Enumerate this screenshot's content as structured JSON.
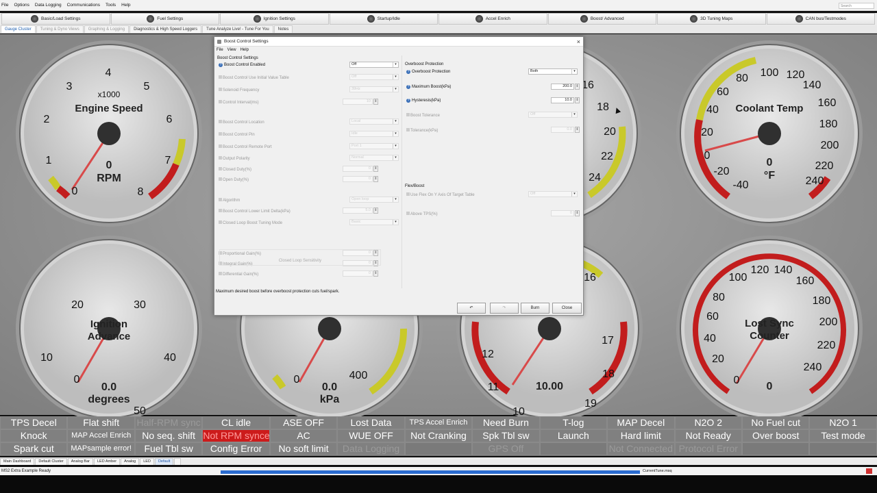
{
  "menu": [
    "File",
    "Options",
    "Data Logging",
    "Communications",
    "Tools",
    "Help"
  ],
  "search_placeholder": "Search",
  "toolbar": [
    "Basic/Load Settings",
    "Fuel Settings",
    "Ignition Settings",
    "Startup/Idle",
    "Accel Enrich",
    "Boost/ Advanced",
    "3D Tuning Maps",
    "CAN bus/Testmodes"
  ],
  "tabs": [
    "Gauge Cluster",
    "Tuning & Dyno Views",
    "Graphing & Logging",
    "Diagnostics & High Speed Loggers",
    "Tune Analyze Live! - Tune For You",
    "Notes"
  ],
  "gauges": {
    "rpm": {
      "title": "Engine Speed",
      "multiplier": "x1000",
      "value": "0",
      "unit": "RPM",
      "ticks": [
        "0",
        "1",
        "2",
        "3",
        "4",
        "5",
        "6",
        "7",
        "8"
      ]
    },
    "coolant": {
      "title": "Coolant Temp",
      "value": "0",
      "unit": "°F",
      "ticks": [
        "-40",
        "-20",
        "0",
        "20",
        "40",
        "60",
        "80",
        "100",
        "120",
        "140",
        "160",
        "180",
        "200",
        "220",
        "240"
      ]
    },
    "ignition": {
      "title_line1": "Ignition",
      "title_line2": "Advance",
      "value": "0.0",
      "unit": "degrees",
      "ticks": [
        "0",
        "10",
        "20",
        "30",
        "40",
        "50"
      ]
    },
    "map": {
      "value": "0.0",
      "unit": "kPa",
      "ticks": [
        "0",
        "400"
      ]
    },
    "afr": {
      "value": "10.00",
      "ticks": [
        "10",
        "11",
        "12",
        "17",
        "18",
        "19"
      ]
    },
    "lostsync": {
      "title_line1": "Lost Sync",
      "title_line2": "Counter",
      "value": "0",
      "ticks": [
        "0",
        "20",
        "40",
        "60",
        "80",
        "100",
        "120",
        "140",
        "160",
        "180",
        "200",
        "220",
        "240"
      ]
    },
    "partial_top": {
      "ticks": [
        "16",
        "18",
        "20",
        "22",
        "24"
      ]
    },
    "partial_bottom": {
      "ticks": [
        "16"
      ]
    }
  },
  "indicators": [
    {
      "t": "TPS Decel"
    },
    {
      "t": "Flat shift"
    },
    {
      "t": "Half-RPM sync",
      "s": "dim"
    },
    {
      "t": "CL idle"
    },
    {
      "t": "ASE OFF"
    },
    {
      "t": "Lost Data"
    },
    {
      "t": "TPS Accel Enrich",
      "s": "small"
    },
    {
      "t": "Need Burn"
    },
    {
      "t": "T-log"
    },
    {
      "t": "MAP Decel"
    },
    {
      "t": "N2O 2"
    },
    {
      "t": "No Fuel cut"
    },
    {
      "t": "N2O 1"
    },
    {
      "t": "Knock"
    },
    {
      "t": "MAP Accel Enrich",
      "s": "small"
    },
    {
      "t": "No seq. shift"
    },
    {
      "t": "Not RPM synced",
      "s": "red"
    },
    {
      "t": "AC"
    },
    {
      "t": "WUE OFF"
    },
    {
      "t": "Not Cranking"
    },
    {
      "t": "Spk Tbl sw"
    },
    {
      "t": "Launch"
    },
    {
      "t": "Hard limit"
    },
    {
      "t": "Not Ready"
    },
    {
      "t": "Over boost"
    },
    {
      "t": "Test mode"
    },
    {
      "t": "Spark cut"
    },
    {
      "t": "MAPsample error!",
      "s": "small"
    },
    {
      "t": "Fuel Tbl sw"
    },
    {
      "t": "Config Error"
    },
    {
      "t": "No soft limit"
    },
    {
      "t": "Data Logging",
      "s": "dim"
    },
    {
      "t": "",
      "s": "empty"
    },
    {
      "t": "GPS Off",
      "s": "dim"
    },
    {
      "t": "",
      "s": "empty"
    },
    {
      "t": "Not Connected",
      "s": "dim"
    },
    {
      "t": "Protocol Error",
      "s": "dim"
    },
    {
      "t": "",
      "s": "empty"
    },
    {
      "t": "",
      "s": "empty"
    }
  ],
  "bottom_tabs": [
    "Main Dashboard",
    "Default Cluster",
    "Analog Bar",
    "LED Amber",
    "Analog",
    "LED",
    "Default"
  ],
  "status": {
    "left": "MS2 Extra Example Ready",
    "right": "CurrentTune.msq"
  },
  "dialog": {
    "title": "Boost Control Settings",
    "menu": [
      "File",
      "View",
      "Help"
    ],
    "left_section": "Boost Control Settings",
    "left_rows": [
      {
        "label": "Boost Control Enabled",
        "value": "Off",
        "kind": "select",
        "enabled": true
      },
      {
        "label": "Boost Control Use Initial Value Table",
        "value": "Off",
        "kind": "select",
        "enabled": false
      },
      {
        "label": "Solenoid Frequency",
        "value": "39Hz",
        "kind": "select",
        "enabled": false
      },
      {
        "label": "Control Interval(ms)",
        "value": "10",
        "kind": "input",
        "enabled": false
      },
      {
        "label": "Boost Control Location",
        "value": "Local",
        "kind": "select",
        "enabled": false
      },
      {
        "label": "Boost Control Pin",
        "value": "Idle",
        "kind": "select",
        "enabled": false
      },
      {
        "label": "Boost Control Remote Port",
        "value": "Port 1",
        "kind": "select",
        "enabled": false
      },
      {
        "label": "Output Polarity",
        "value": "Normal",
        "kind": "select",
        "enabled": false
      },
      {
        "label": "Closed Duty(%)",
        "value": "0",
        "kind": "input",
        "enabled": false
      },
      {
        "label": "Open Duty(%)",
        "value": "0",
        "kind": "input",
        "enabled": false
      },
      {
        "label": "Algorithm",
        "value": "Open loop",
        "kind": "select",
        "enabled": false
      },
      {
        "label": "Boost Control Lower Limit Delta(kPa)",
        "value": "5.0",
        "kind": "input",
        "enabled": false
      },
      {
        "label": "Closed Loop Boost Tuning Mode",
        "value": "Basic",
        "kind": "select",
        "enabled": false
      },
      {
        "label": "Proportional Gain(%)",
        "value": "0",
        "kind": "input",
        "enabled": false
      },
      {
        "label": "Integral Gain(%)",
        "value": "0",
        "kind": "input",
        "enabled": false
      },
      {
        "label": "Differential Gain(%)",
        "value": "0",
        "kind": "input",
        "enabled": false
      }
    ],
    "slider_label": "Closed Loop Sensitivity",
    "right_section": "Overboost Protection",
    "right_rows": [
      {
        "label": "Overboost Protection",
        "value": "Both",
        "kind": "select",
        "enabled": true
      },
      {
        "label": "Maximum Boost(kPa)",
        "value": "200.0",
        "kind": "input",
        "enabled": true
      },
      {
        "label": "Hysteresis(kPa)",
        "value": "10.0",
        "kind": "input",
        "enabled": true
      },
      {
        "label": "Boost Tolerance",
        "value": "Off",
        "kind": "select",
        "enabled": false
      },
      {
        "label": "Tolerance(kPa)",
        "value": "0.0",
        "kind": "input",
        "enabled": false
      }
    ],
    "flex_section": "Flex/Boost",
    "flex_rows": [
      {
        "label": "Use Flex On Y Axis Of Target Table",
        "value": "Off",
        "kind": "select",
        "enabled": false
      },
      {
        "label": "Above TPS(%)",
        "value": "0",
        "kind": "input",
        "enabled": false
      }
    ],
    "hint": "Maximum desired boost before overboost protection cuts fuel/spark.",
    "buttons": {
      "undo": "↶",
      "redo": "↷",
      "burn": "Burn",
      "close": "Close"
    }
  }
}
